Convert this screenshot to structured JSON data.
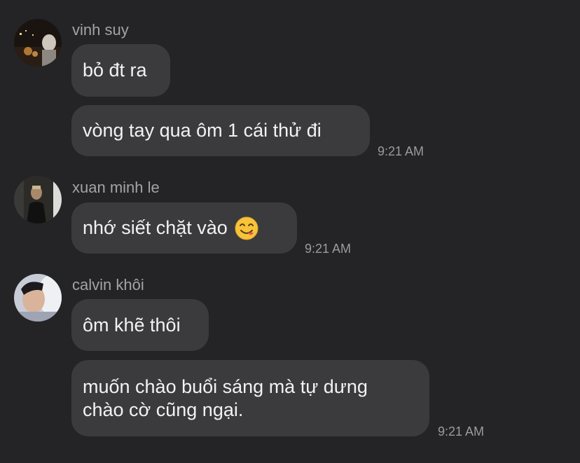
{
  "messages_groups": [
    {
      "sender": "vinh suy",
      "messages": [
        "bỏ đt ra",
        "vòng tay qua ôm 1 cái thử đi"
      ],
      "time": "9:21 AM"
    },
    {
      "sender": "xuan minh le",
      "messages": [
        "nhớ siết chặt vào"
      ],
      "emoji": "yum-face-emoji",
      "time": "9:21 AM"
    },
    {
      "sender": "calvin khôi",
      "messages": [
        "ôm khẽ thôi"
      ],
      "multiline": [
        "muốn chào buổi sáng mà tự dưng",
        "chào cờ cũng ngại."
      ],
      "time": "9:21 AM"
    }
  ],
  "colors": {
    "background": "#242426",
    "bubble": "#3b3b3d",
    "text": "#f2f2f4",
    "meta": "#9b9ba0"
  }
}
